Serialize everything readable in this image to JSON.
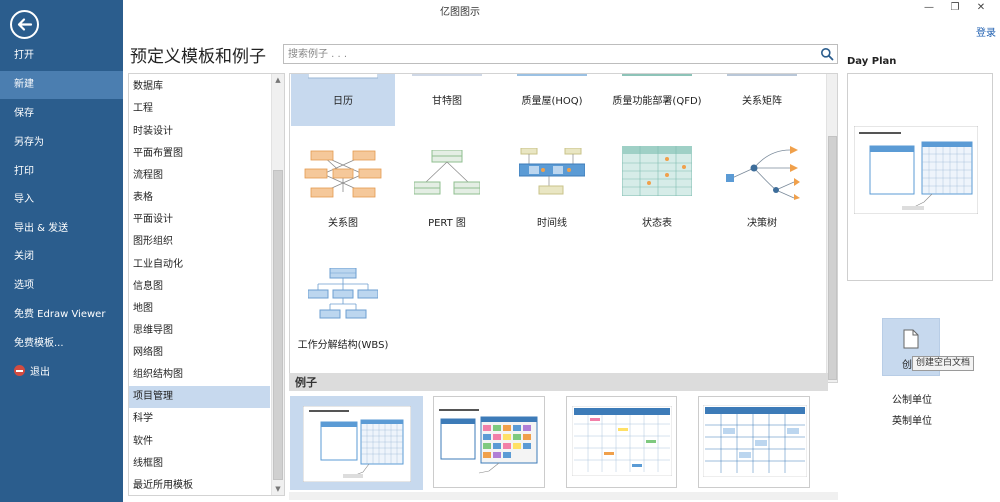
{
  "window": {
    "title": "亿图图示",
    "minimize_glyph": "—",
    "restore_glyph": "❐",
    "close_glyph": "✕"
  },
  "header": {
    "login": "登录"
  },
  "backstage": {
    "items": [
      {
        "label": "打开"
      },
      {
        "label": "新建"
      },
      {
        "label": "保存"
      },
      {
        "label": "另存为"
      },
      {
        "label": "打印"
      },
      {
        "label": "导入"
      },
      {
        "label": "导出 & 发送"
      },
      {
        "label": "关闭"
      },
      {
        "label": "选项"
      },
      {
        "label": "免费 Edraw Viewer"
      },
      {
        "label": "免费模板..."
      },
      {
        "label": "退出"
      }
    ],
    "selected": "新建"
  },
  "main": {
    "title": "预定义模板和例子",
    "search": {
      "placeholder": "搜索例子 . . ."
    }
  },
  "categories": {
    "items": [
      "数据库",
      "工程",
      "时装设计",
      "平面布置图",
      "流程图",
      "表格",
      "平面设计",
      "图形组织",
      "工业自动化",
      "信息图",
      "地图",
      "思维导图",
      "网络图",
      "组织结构图",
      "项目管理",
      "科学",
      "软件",
      "线框图",
      "最近所用模板"
    ],
    "selected": "项目管理"
  },
  "templates": {
    "items": [
      {
        "label": "日历"
      },
      {
        "label": "甘特图"
      },
      {
        "label": "质量屋(HOQ)"
      },
      {
        "label": "质量功能部署(QFD)"
      },
      {
        "label": "关系矩阵"
      },
      {
        "label": "关系图"
      },
      {
        "label": "PERT 图"
      },
      {
        "label": "时间线"
      },
      {
        "label": "状态表"
      },
      {
        "label": "决策树"
      },
      {
        "label": "工作分解结构(WBS)"
      }
    ],
    "selected": "日历"
  },
  "examples": {
    "label": "例子"
  },
  "preview": {
    "title": "Day Plan",
    "create_blank": "创",
    "tooltip": "创建空白文档",
    "units": [
      "公制单位",
      "英制单位"
    ]
  },
  "colors": {
    "sidebar": "#2b5d8d",
    "sidebar_selected": "#4b7eb0",
    "selection": "#c7d9ee",
    "accent_orange": "#f0a04b",
    "accent_blue": "#5b9bd5"
  }
}
